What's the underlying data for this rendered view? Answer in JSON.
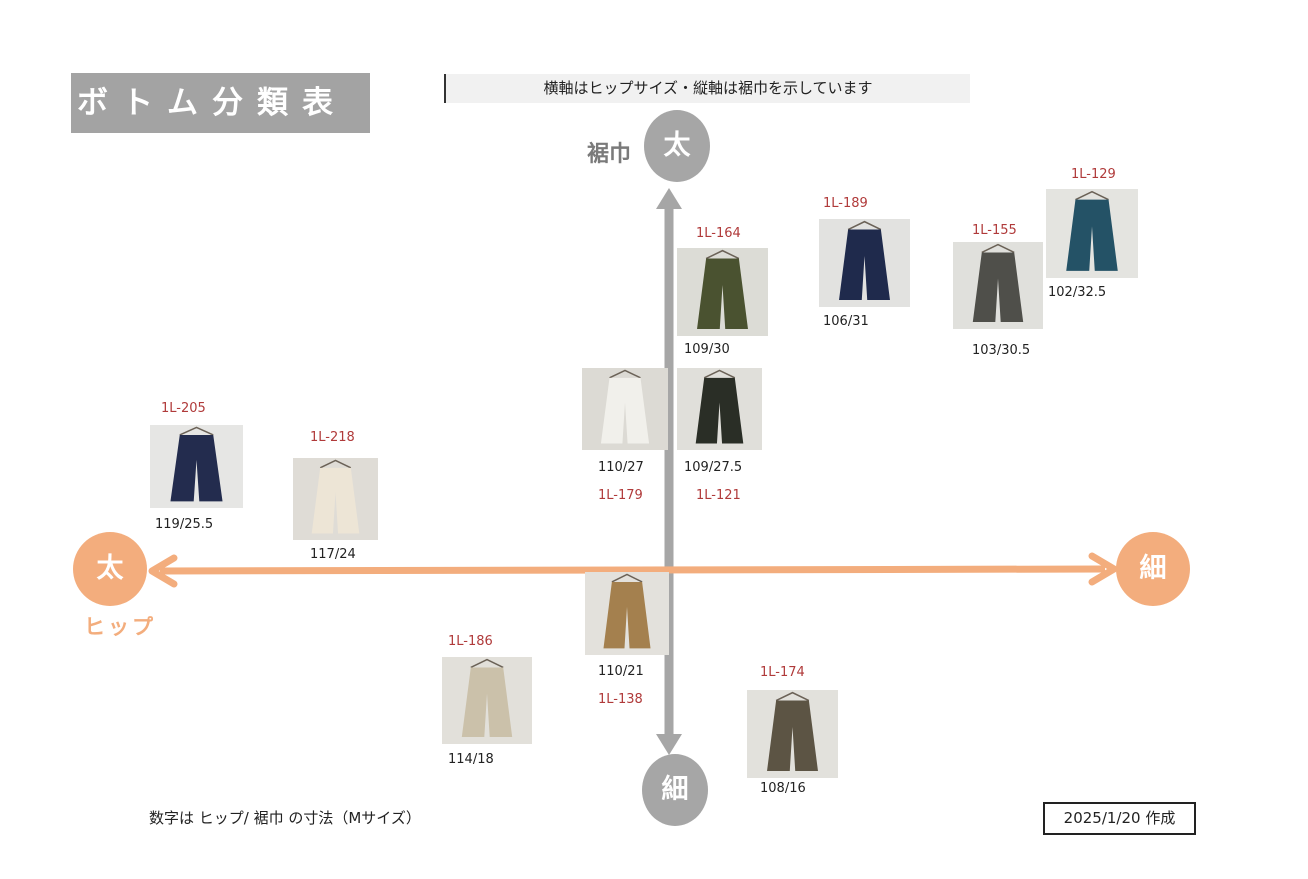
{
  "title": "ボトム分類表",
  "subtitle": "横軸はヒップサイズ・縦軸は裾巾を示しています",
  "vertical_axis": {
    "label": "裾巾",
    "top_label": "太",
    "bottom_label": "細"
  },
  "horizontal_axis": {
    "label": "ヒップ",
    "left_label": "太",
    "right_label": "細"
  },
  "colors": {
    "title_bg": "#a3a3a3",
    "vertical_axis": "#a6a6a6",
    "horizontal_axis": "#f3ad7d",
    "code_text": "#b03a3a"
  },
  "products": [
    {
      "code": "1L-164",
      "size": "109/30",
      "pants_color": "#4a5230",
      "bg": "#dcdcd6"
    },
    {
      "code": "1L-189",
      "size": "106/31",
      "pants_color": "#1f2a4c",
      "bg": "#e2e2e0"
    },
    {
      "code": "1L-155",
      "size": "103/30.5",
      "pants_color": "#4f4f4a",
      "bg": "#e0e0dc"
    },
    {
      "code": "1L-129",
      "size": "102/32.5",
      "pants_color": "#245266",
      "bg": "#e4e4e0"
    },
    {
      "code": "1L-179",
      "size": "110/27",
      "pants_color": "#f1f0eb",
      "bg": "#dcdad4"
    },
    {
      "code": "1L-121",
      "size": "109/27.5",
      "pants_color": "#2a2e26",
      "bg": "#e0dfda"
    },
    {
      "code": "1L-205",
      "size": "119/25.5",
      "pants_color": "#232c4e",
      "bg": "#e6e6e4"
    },
    {
      "code": "1L-218",
      "size": "117/24",
      "pants_color": "#ede5d6",
      "bg": "#dfdcd6"
    },
    {
      "code": "1L-138",
      "size": "110/21",
      "pants_color": "#a4804e",
      "bg": "#e3e1dc"
    },
    {
      "code": "1L-186",
      "size": "114/18",
      "pants_color": "#cbc1aa",
      "bg": "#e2e0da"
    },
    {
      "code": "1L-174",
      "size": "108/16",
      "pants_color": "#5c5444",
      "bg": "#e2e1dc"
    }
  ],
  "note": "数字は ヒップ/ 裾巾 の寸法（Mサイズ）",
  "created": "2025/1/20 作成"
}
